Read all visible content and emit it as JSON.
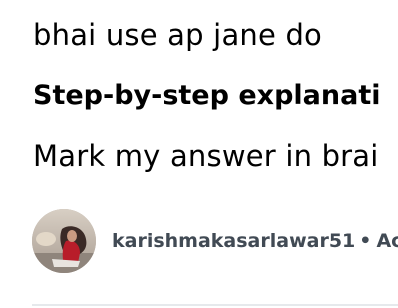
{
  "answer": {
    "line_1": "bhai use ap jane do",
    "heading": "Step-by-step explanati",
    "line_3": "Mark my answer in brai"
  },
  "answerer": {
    "avatar_icon": "user-avatar",
    "username": "karishmakasarlawar51",
    "separator": "•",
    "trailing_text": "Ac"
  },
  "colors": {
    "text": "#000000",
    "meta_text": "#414a54",
    "divider": "#e6e9ec"
  }
}
